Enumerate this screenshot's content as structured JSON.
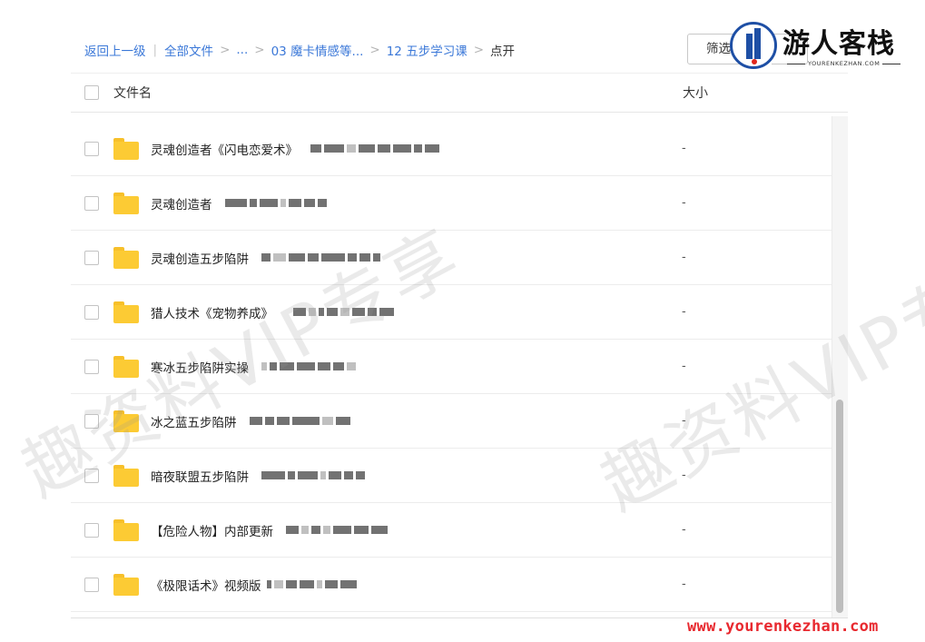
{
  "breadcrumb": {
    "back": "返回上一级",
    "all_files": "全部文件",
    "ellipsis": "...",
    "level1": "03 魔卡情感等...",
    "level2": "12 五步学习课",
    "current": "点开"
  },
  "toolbar": {
    "filter_label": "筛选"
  },
  "logo": {
    "title": "游人客栈",
    "subtitle": "YOURENKEZHAN.COM"
  },
  "table": {
    "name_header": "文件名",
    "size_header": "大小",
    "rows": [
      {
        "name": "灵魂创造者《闪电恋爱术》",
        "size": "-"
      },
      {
        "name": "灵魂创造者",
        "size": "-"
      },
      {
        "name": "灵魂创造五步陷阱",
        "size": "-"
      },
      {
        "name": "猎人技术《宠物养成》",
        "size": "-"
      },
      {
        "name": "寒冰五步陷阱实操",
        "size": "-"
      },
      {
        "name": "冰之蓝五步陷阱",
        "size": "-"
      },
      {
        "name": "暗夜联盟五步陷阱",
        "size": "-"
      },
      {
        "name": "【危险人物】内部更新",
        "size": "-"
      },
      {
        "name": "《极限话术》视频版",
        "size": "-"
      }
    ]
  },
  "watermark": {
    "text": "趣资料VIP专享"
  },
  "footer": {
    "site_url": "www.yourenkezhan.com"
  },
  "colors": {
    "link": "#3b78d8",
    "folder": "#fccb34",
    "logo_blue": "#1e4fa5",
    "site_red": "#e8292f"
  }
}
